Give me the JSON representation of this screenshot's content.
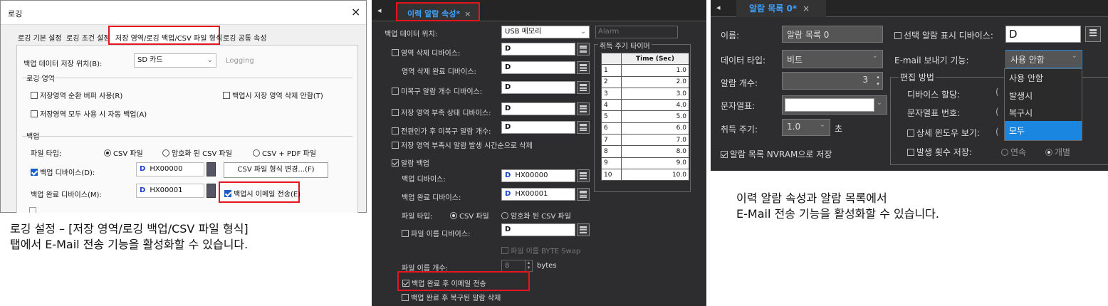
{
  "panel1": {
    "title": "로깅",
    "close": "×",
    "tabs": [
      "로깅 기본 설정",
      "로깅 조건 설정",
      "저장 영역/로깅 백업/CSV 파일 형식",
      "로깅 공통 속성"
    ],
    "backup_location_label": "백업 데이터 저장 위치(B):",
    "backup_location_value": "SD 카드",
    "logging_text": "Logging",
    "section_area": "로깅 영역",
    "ring_buffer": "저장영역 순환 버퍼 사용(R)",
    "no_delete": "백업시 저장 영역 삭제 안함(T)",
    "auto_backup": "저장영역 모두 사용 시 자동 백업(A)",
    "section_backup": "백업",
    "file_type_label": "파일 타입:",
    "ft_csv": "CSV 파일",
    "ft_enc": "암호화 된 CSV 파일",
    "ft_pdf": "CSV + PDF 파일",
    "backup_device_label": "백업 디바이스(D):",
    "backup_device_value": "HX00000",
    "device_prefix": "D",
    "csv_button": "CSV 파일 형식 변경...(F)",
    "complete_device_label": "백업 완료 디바이스(M):",
    "complete_device_value": "HX00001",
    "email_on_backup": "백업시 이메일 전송(E)"
  },
  "caption1": [
    "로깅 설정 – [저장 영역/로깅 백업/CSV 파일 형식]",
    "탭에서 E-Mail 전송 기능을 활성화할 수 있습니다."
  ],
  "panel2": {
    "tab": "이력 알람 속성*",
    "tab_close": "×",
    "nav": "◂",
    "backup_loc_label": "백업 데이터 위치:",
    "backup_loc_value": "USB 메모리",
    "alarm_text": "Alarm",
    "area_delete_device": "영역 삭제 디바이스:",
    "area_delete_done": "영역 삭제 완료 디바이스:",
    "unrecovered_count": "미복구 알람 개수 디바이스:",
    "shortage_status": "저장 영역 부족 상태 디바이스:",
    "power_unrecovered": "전원인가 후 미복구 알람 개수:",
    "delete_by_time": "저장 영역 부족시 알람 발생 시간순으로 삭제",
    "alarm_backup": "알람 백업",
    "backup_device": "백업 디바이스:",
    "backup_device_value": "HX00000",
    "backup_done_device": "백업 완료 디바이스:",
    "backup_done_value": "HX00001",
    "file_type": "파일 타입:",
    "ft_csv": "CSV 파일",
    "ft_enc": "암호화 된 CSV 파일",
    "file_name_device": "파일 이름 디바이스:",
    "byte_swap": "파일 이름 BYTE Swap",
    "file_name_count": "파일 이름 개수:",
    "file_name_count_value": "8",
    "bytes": "bytes",
    "email_after_backup": "백업 완료 후 이메일 전송",
    "delete_recovered": "백업 완료 후 복구된 알람 삭제",
    "device_prefix": "D",
    "timer_title": "취득 주기 타이머",
    "timer_header": "Time (Sec)",
    "timer_rows": [
      {
        "n": "1",
        "v": "1.0"
      },
      {
        "n": "2",
        "v": "2.0"
      },
      {
        "n": "3",
        "v": "3.0"
      },
      {
        "n": "4",
        "v": "4.0"
      },
      {
        "n": "5",
        "v": "5.0"
      },
      {
        "n": "6",
        "v": "6.0"
      },
      {
        "n": "7",
        "v": "7.0"
      },
      {
        "n": "8",
        "v": "8.0"
      },
      {
        "n": "9",
        "v": "9.0"
      },
      {
        "n": "10",
        "v": "10.0"
      }
    ]
  },
  "panel3": {
    "tab": "알람 목록 0*",
    "tab_close": "×",
    "nav": "◂",
    "name_label": "이름:",
    "name_value": "알람 목록 0",
    "select_display_label": "선택 알람 표시 디바이스:",
    "device_prefix": "D",
    "data_type_label": "데이터 타입:",
    "data_type_value": "비트",
    "email_label": "E-mail 보내기 기능:",
    "email_value": "사용 안함",
    "alarm_count_label": "알람 개수:",
    "alarm_count_value": "3",
    "edit_method": "편집 방법",
    "device_assign": "디바이스 할당:",
    "string_table_label": "문자열표:",
    "string_table_no": "문자열표 번호:",
    "acq_cycle_label": "취득 주기:",
    "acq_cycle_value": "1.0",
    "acq_unit": "초",
    "detail_window": "상세 윈도우 보기:",
    "nvram": "알람 목록 NVRAM으로 저장",
    "occur_count": "발생 횟수 저장:",
    "continuous": "연속",
    "individual": "개별",
    "dropdown_options": [
      "사용 안함",
      "발생시",
      "복구시",
      "모두"
    ]
  },
  "caption3": [
    "이력 알람 속성과 알람 목록에서",
    "E-Mail 전송 기능을 활성화할 수 있습니다."
  ]
}
